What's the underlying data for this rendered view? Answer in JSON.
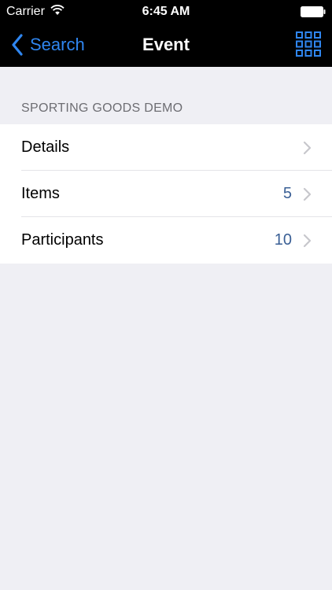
{
  "status_bar": {
    "carrier": "Carrier",
    "time": "6:45 AM",
    "wifi_icon": "wifi-icon",
    "battery_icon": "battery-icon"
  },
  "nav_bar": {
    "back_label": "Search",
    "title": "Event",
    "grid_icon": "grid-icon",
    "accent_color": "#2f86f0"
  },
  "section": {
    "header": "SPORTING GOODS DEMO"
  },
  "rows": [
    {
      "label": "Details",
      "detail": ""
    },
    {
      "label": "Items",
      "detail": "5"
    },
    {
      "label": "Participants",
      "detail": "10"
    }
  ],
  "colors": {
    "background": "#efeff4",
    "detail_text": "#3a5f95",
    "chevron": "#c7c7cc"
  }
}
